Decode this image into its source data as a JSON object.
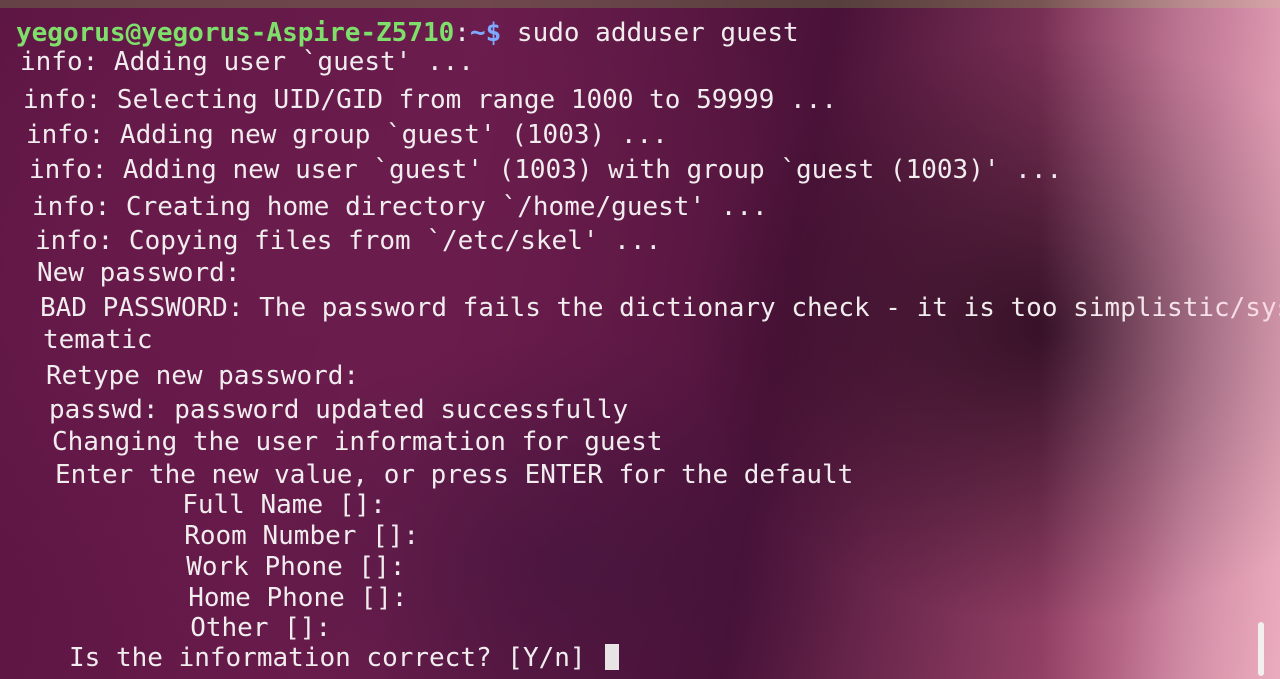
{
  "prompt": {
    "user_host": "yegorus@yegorus-Aspire-Z5710",
    "colon": ":",
    "path": "~$",
    "command": " sudo adduser guest"
  },
  "lines": [
    "info: Adding user `guest' ...",
    "info: Selecting UID/GID from range 1000 to 59999 ...",
    "info: Adding new group `guest' (1003) ...",
    "info: Adding new user `guest' (1003) with group `guest (1003)' ...",
    "info: Creating home directory `/home/guest' ...",
    "info: Copying files from `/etc/skel' ...",
    "New password:",
    "BAD PASSWORD: The password fails the dictionary check - it is too simplistic/sys",
    "tematic",
    "Retype new password:",
    "passwd: password updated successfully",
    "Changing the user information for guest",
    "Enter the new value, or press ENTER for the default",
    "        Full Name []:",
    "        Room Number []:",
    "        Work Phone []:",
    "        Home Phone []:",
    "        Other []:"
  ],
  "final_prompt": "Is the information correct? [Y/n] "
}
